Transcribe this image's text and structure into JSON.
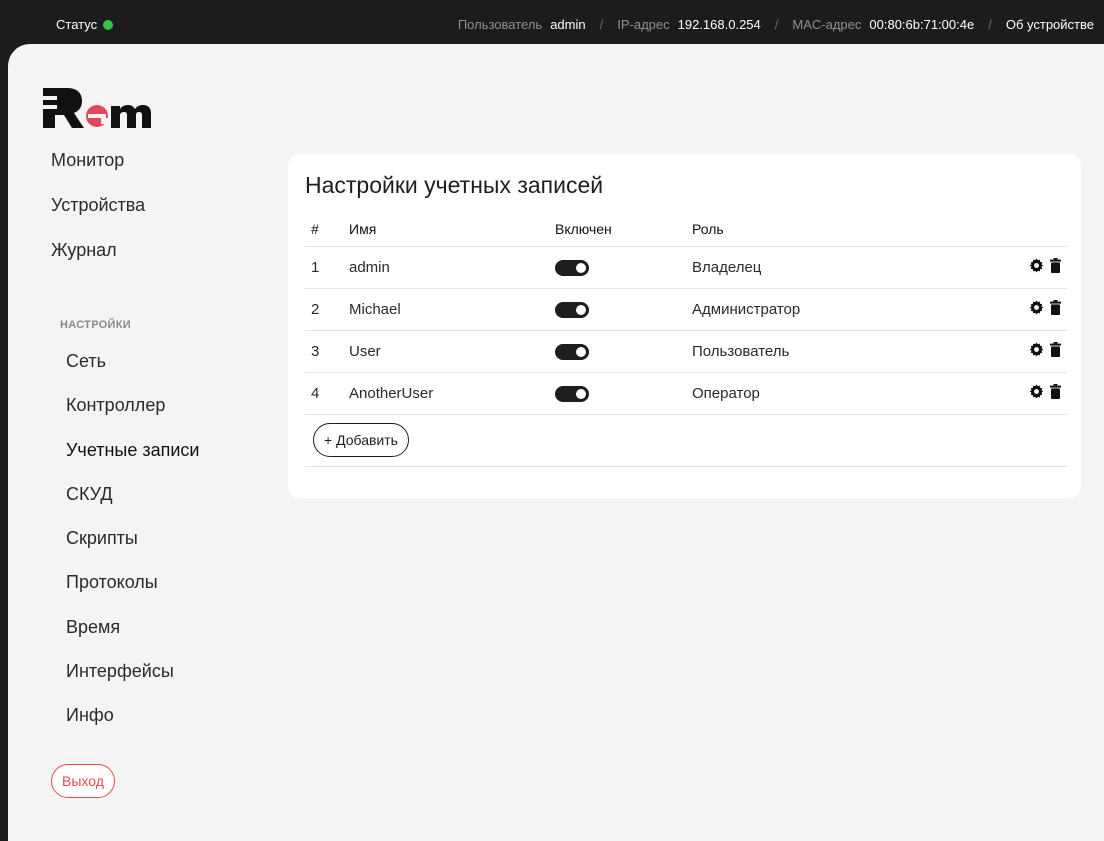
{
  "topbar": {
    "status_label": "Статус",
    "user_label": "Пользователь",
    "user_value": "admin",
    "ip_label": "IP-адрес",
    "ip_value": "192.168.0.254",
    "mac_label": "MAC-адрес",
    "mac_value": "00:80:6b:71:00:4e",
    "about_link": "Об устройстве",
    "status_color": "#36c24a"
  },
  "logo": {
    "text": "Rem",
    "accent_color": "#e0485a"
  },
  "nav": {
    "items": [
      "Монитор",
      "Устройства",
      "Журнал"
    ],
    "settings_title": "НАСТРОЙКИ",
    "settings_items": [
      "Сеть",
      "Контроллер",
      "Учетные записи",
      "СКУД",
      "Скрипты",
      "Протоколы",
      "Время",
      "Интерфейсы",
      "Инфо"
    ],
    "active": "Учетные записи",
    "logout_label": "Выход"
  },
  "accounts": {
    "title": "Настройки учетных записей",
    "columns": [
      "#",
      "Имя",
      "Включен",
      "Роль"
    ],
    "rows": [
      {
        "num": "1",
        "name": "admin",
        "enabled": true,
        "role": "Владелец"
      },
      {
        "num": "2",
        "name": "Michael",
        "enabled": true,
        "role": "Администратор"
      },
      {
        "num": "3",
        "name": "User",
        "enabled": true,
        "role": "Пользователь"
      },
      {
        "num": "4",
        "name": "AnotherUser",
        "enabled": true,
        "role": "Оператор"
      }
    ],
    "add_label": "+ Добавить",
    "row_icons": [
      "gear-icon",
      "trash-icon"
    ]
  }
}
